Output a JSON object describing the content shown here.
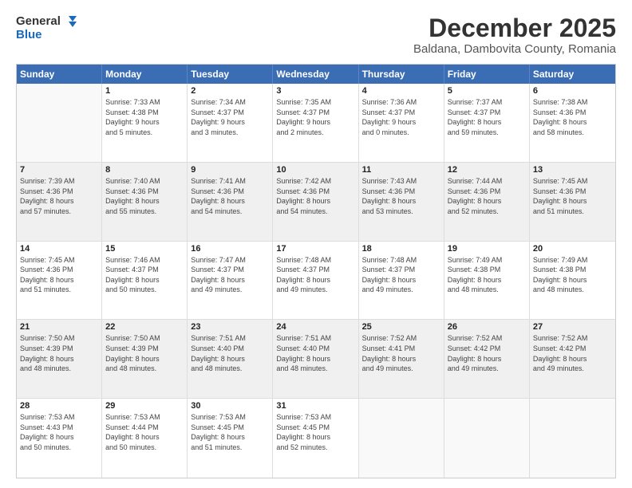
{
  "logo": {
    "line1": "General",
    "line2": "Blue"
  },
  "title": "December 2025",
  "subtitle": "Baldana, Dambovita County, Romania",
  "header_days": [
    "Sunday",
    "Monday",
    "Tuesday",
    "Wednesday",
    "Thursday",
    "Friday",
    "Saturday"
  ],
  "weeks": [
    [
      {
        "day": "",
        "info": ""
      },
      {
        "day": "1",
        "info": "Sunrise: 7:33 AM\nSunset: 4:38 PM\nDaylight: 9 hours\nand 5 minutes."
      },
      {
        "day": "2",
        "info": "Sunrise: 7:34 AM\nSunset: 4:37 PM\nDaylight: 9 hours\nand 3 minutes."
      },
      {
        "day": "3",
        "info": "Sunrise: 7:35 AM\nSunset: 4:37 PM\nDaylight: 9 hours\nand 2 minutes."
      },
      {
        "day": "4",
        "info": "Sunrise: 7:36 AM\nSunset: 4:37 PM\nDaylight: 9 hours\nand 0 minutes."
      },
      {
        "day": "5",
        "info": "Sunrise: 7:37 AM\nSunset: 4:37 PM\nDaylight: 8 hours\nand 59 minutes."
      },
      {
        "day": "6",
        "info": "Sunrise: 7:38 AM\nSunset: 4:36 PM\nDaylight: 8 hours\nand 58 minutes."
      }
    ],
    [
      {
        "day": "7",
        "info": "Sunrise: 7:39 AM\nSunset: 4:36 PM\nDaylight: 8 hours\nand 57 minutes."
      },
      {
        "day": "8",
        "info": "Sunrise: 7:40 AM\nSunset: 4:36 PM\nDaylight: 8 hours\nand 55 minutes."
      },
      {
        "day": "9",
        "info": "Sunrise: 7:41 AM\nSunset: 4:36 PM\nDaylight: 8 hours\nand 54 minutes."
      },
      {
        "day": "10",
        "info": "Sunrise: 7:42 AM\nSunset: 4:36 PM\nDaylight: 8 hours\nand 54 minutes."
      },
      {
        "day": "11",
        "info": "Sunrise: 7:43 AM\nSunset: 4:36 PM\nDaylight: 8 hours\nand 53 minutes."
      },
      {
        "day": "12",
        "info": "Sunrise: 7:44 AM\nSunset: 4:36 PM\nDaylight: 8 hours\nand 52 minutes."
      },
      {
        "day": "13",
        "info": "Sunrise: 7:45 AM\nSunset: 4:36 PM\nDaylight: 8 hours\nand 51 minutes."
      }
    ],
    [
      {
        "day": "14",
        "info": "Sunrise: 7:45 AM\nSunset: 4:36 PM\nDaylight: 8 hours\nand 51 minutes."
      },
      {
        "day": "15",
        "info": "Sunrise: 7:46 AM\nSunset: 4:37 PM\nDaylight: 8 hours\nand 50 minutes."
      },
      {
        "day": "16",
        "info": "Sunrise: 7:47 AM\nSunset: 4:37 PM\nDaylight: 8 hours\nand 49 minutes."
      },
      {
        "day": "17",
        "info": "Sunrise: 7:48 AM\nSunset: 4:37 PM\nDaylight: 8 hours\nand 49 minutes."
      },
      {
        "day": "18",
        "info": "Sunrise: 7:48 AM\nSunset: 4:37 PM\nDaylight: 8 hours\nand 49 minutes."
      },
      {
        "day": "19",
        "info": "Sunrise: 7:49 AM\nSunset: 4:38 PM\nDaylight: 8 hours\nand 48 minutes."
      },
      {
        "day": "20",
        "info": "Sunrise: 7:49 AM\nSunset: 4:38 PM\nDaylight: 8 hours\nand 48 minutes."
      }
    ],
    [
      {
        "day": "21",
        "info": "Sunrise: 7:50 AM\nSunset: 4:39 PM\nDaylight: 8 hours\nand 48 minutes."
      },
      {
        "day": "22",
        "info": "Sunrise: 7:50 AM\nSunset: 4:39 PM\nDaylight: 8 hours\nand 48 minutes."
      },
      {
        "day": "23",
        "info": "Sunrise: 7:51 AM\nSunset: 4:40 PM\nDaylight: 8 hours\nand 48 minutes."
      },
      {
        "day": "24",
        "info": "Sunrise: 7:51 AM\nSunset: 4:40 PM\nDaylight: 8 hours\nand 48 minutes."
      },
      {
        "day": "25",
        "info": "Sunrise: 7:52 AM\nSunset: 4:41 PM\nDaylight: 8 hours\nand 49 minutes."
      },
      {
        "day": "26",
        "info": "Sunrise: 7:52 AM\nSunset: 4:42 PM\nDaylight: 8 hours\nand 49 minutes."
      },
      {
        "day": "27",
        "info": "Sunrise: 7:52 AM\nSunset: 4:42 PM\nDaylight: 8 hours\nand 49 minutes."
      }
    ],
    [
      {
        "day": "28",
        "info": "Sunrise: 7:53 AM\nSunset: 4:43 PM\nDaylight: 8 hours\nand 50 minutes."
      },
      {
        "day": "29",
        "info": "Sunrise: 7:53 AM\nSunset: 4:44 PM\nDaylight: 8 hours\nand 50 minutes."
      },
      {
        "day": "30",
        "info": "Sunrise: 7:53 AM\nSunset: 4:45 PM\nDaylight: 8 hours\nand 51 minutes."
      },
      {
        "day": "31",
        "info": "Sunrise: 7:53 AM\nSunset: 4:45 PM\nDaylight: 8 hours\nand 52 minutes."
      },
      {
        "day": "",
        "info": ""
      },
      {
        "day": "",
        "info": ""
      },
      {
        "day": "",
        "info": ""
      }
    ]
  ],
  "shaded_rows": [
    1,
    3
  ],
  "colors": {
    "header_bg": "#3b6db5",
    "header_text": "#ffffff",
    "shaded_bg": "#f0f0f0",
    "normal_bg": "#ffffff",
    "border": "#dddddd"
  }
}
